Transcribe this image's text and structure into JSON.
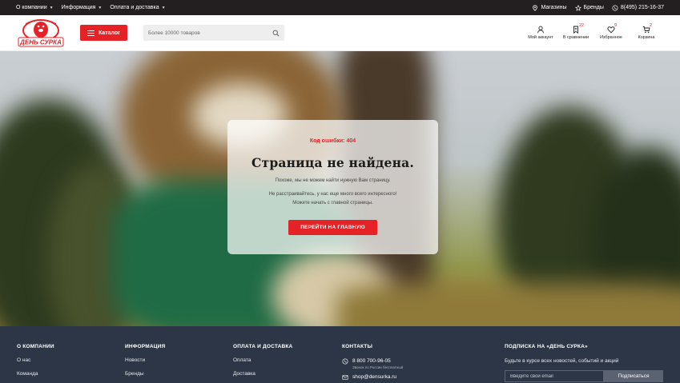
{
  "topbar": {
    "menu": [
      {
        "label": "О компании"
      },
      {
        "label": "Информация"
      },
      {
        "label": "Оплата и доставка"
      }
    ],
    "stores_label": "Магазины",
    "brands_label": "Бренды",
    "phone": "8(495) 215-16-37"
  },
  "header": {
    "logo_text": "ДЕНЬ СУРКА",
    "catalog_label": "Каталог",
    "search_placeholder": "Более 10000 товаров",
    "icons": [
      {
        "label": "Мой аккаунт",
        "badge": "",
        "icon": "user-icon"
      },
      {
        "label": "В сравнении",
        "badge": "22",
        "icon": "compare-icon"
      },
      {
        "label": "Избранное",
        "badge": "9",
        "icon": "heart-icon"
      },
      {
        "label": "Корзина",
        "badge": "2",
        "icon": "cart-icon"
      }
    ],
    "accent_color": "#e52326"
  },
  "error": {
    "code_label": "Код ошибки: 404",
    "title": "Страница не найдена.",
    "subtitle": "Похоже, мы не можем найти нужную Вам страницу.",
    "message_line1": "Не расстраивайтесь, у нас еще много всего интересного!",
    "message_line2": "Можете начать с главной страницы.",
    "home_button": "ПЕРЕЙТИ НА ГЛАВНУЮ"
  },
  "footer": {
    "about": {
      "title": "О КОМПАНИИ",
      "items": [
        "О нас",
        "Команда"
      ]
    },
    "info": {
      "title": "ИНФОРМАЦИЯ",
      "items": [
        "Новости",
        "Бренды"
      ]
    },
    "delivery": {
      "title": "ОПЛАТА И ДОСТАВКА",
      "items": [
        "Оплата",
        "Доставка"
      ]
    },
    "contacts": {
      "title": "КОНТАКТЫ",
      "phone": "8 800 700-96-05",
      "phone_note": "Звонок по России бесплатный",
      "email": "shop@densurka.ru"
    },
    "subscribe": {
      "title": "ПОДПИСКА НА «ДЕНЬ СУРКА»",
      "text": "Будьте в курсе всех новостей, событий и акций",
      "placeholder": "Введите свой email",
      "button": "Подписаться"
    },
    "background_color": "#2d3646"
  }
}
